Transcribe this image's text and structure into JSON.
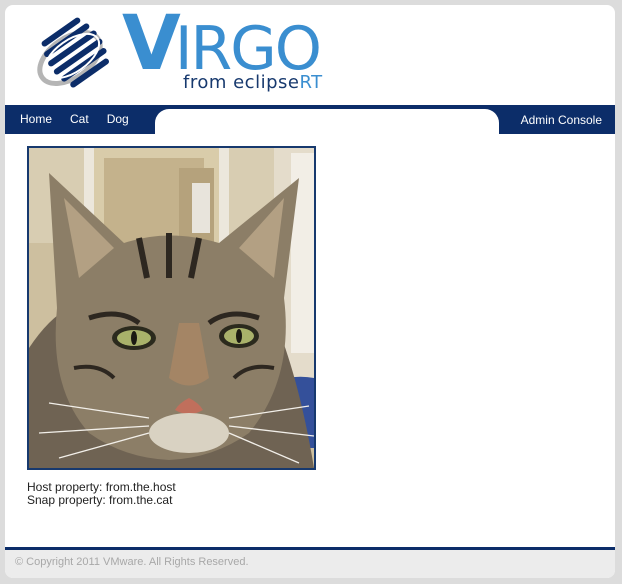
{
  "logo": {
    "word_initial": "V",
    "word_rest": "IRGO",
    "sub_prefix": "from eclipse",
    "sub_suffix": "RT",
    "icon": "virgo-sphere-logo-icon"
  },
  "nav": {
    "left_items": [
      {
        "label": "Home"
      },
      {
        "label": "Cat"
      },
      {
        "label": "Dog"
      }
    ],
    "right_item": {
      "label": "Admin Console"
    }
  },
  "content": {
    "photo_icon": "tabby-cat-photo",
    "host_property": "Host property: from.the.host",
    "snap_property": "Snap property: from.the.cat"
  },
  "footer": {
    "copyright": "© Copyright 2011 VMware. All Rights Reserved."
  },
  "colors": {
    "brand_navy": "#0c2d69",
    "brand_blue": "#3a8ed0",
    "page_bg": "#dcdcdc"
  }
}
